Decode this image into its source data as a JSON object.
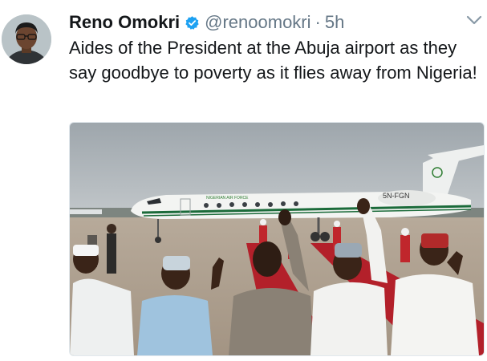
{
  "tweet": {
    "author_name": "Reno Omokri",
    "handle": "@renoomokri",
    "separator": "·",
    "time": "5h",
    "text": "Aides of the President at the Abuja airport as they say goodbye to poverty as it flies away from Nigeria!",
    "verified": true
  },
  "photo": {
    "aircraft_registration": "5N-FGN",
    "aircraft_livery_text": "NIGERIAN AIR FORCE"
  },
  "colors": {
    "verified_blue": "#1da1f2",
    "secondary_text": "#657786",
    "primary_text": "#14171a"
  },
  "icons": [
    "verified-badge-icon",
    "chevron-down-icon"
  ]
}
